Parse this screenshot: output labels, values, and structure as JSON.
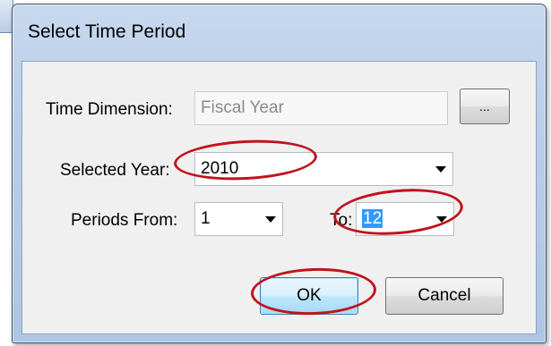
{
  "dialog": {
    "title": "Select Time Period"
  },
  "time_dimension": {
    "label": "Time Dimension:",
    "value": "Fiscal Year",
    "browse_label": "..."
  },
  "selected_year": {
    "label": "Selected Year:",
    "value": "2010"
  },
  "periods": {
    "from_label": "Periods From:",
    "from_value": "1",
    "to_label": "To:",
    "to_value": "12"
  },
  "buttons": {
    "ok_label": "OK",
    "cancel_label": "Cancel"
  },
  "annotations": {
    "highlight_color": "#c0121c"
  }
}
